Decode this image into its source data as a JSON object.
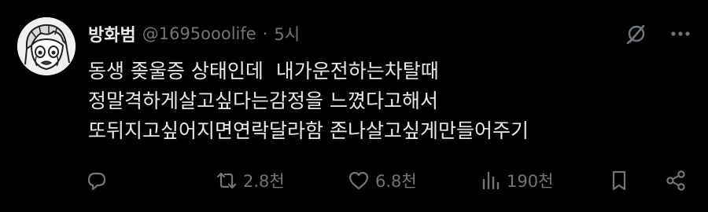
{
  "post": {
    "author": {
      "display_name": "방화범",
      "handle": "@1695ooolife",
      "separator": "·",
      "time": "5시"
    },
    "text_lines": [
      "동생 좆울증 상태인데  내가운전하는차탈때",
      "정말격하게살고싶다는감정을 느꼈다고해서",
      "또뒤지고싶어지면연락달라함 존나살고싶게만들어주기"
    ],
    "stats": {
      "replies": "",
      "reposts": "2.8천",
      "likes": "6.8천",
      "views": "190천"
    },
    "colors": {
      "background": "#000000",
      "text": "#e7e9ea",
      "muted": "#71767b"
    },
    "icons": {
      "grok": "grok-icon",
      "more": "more-icon",
      "reply": "reply-icon",
      "repost": "repost-icon",
      "like": "heart-icon",
      "views": "views-icon",
      "bookmark": "bookmark-icon",
      "share": "share-icon"
    }
  }
}
